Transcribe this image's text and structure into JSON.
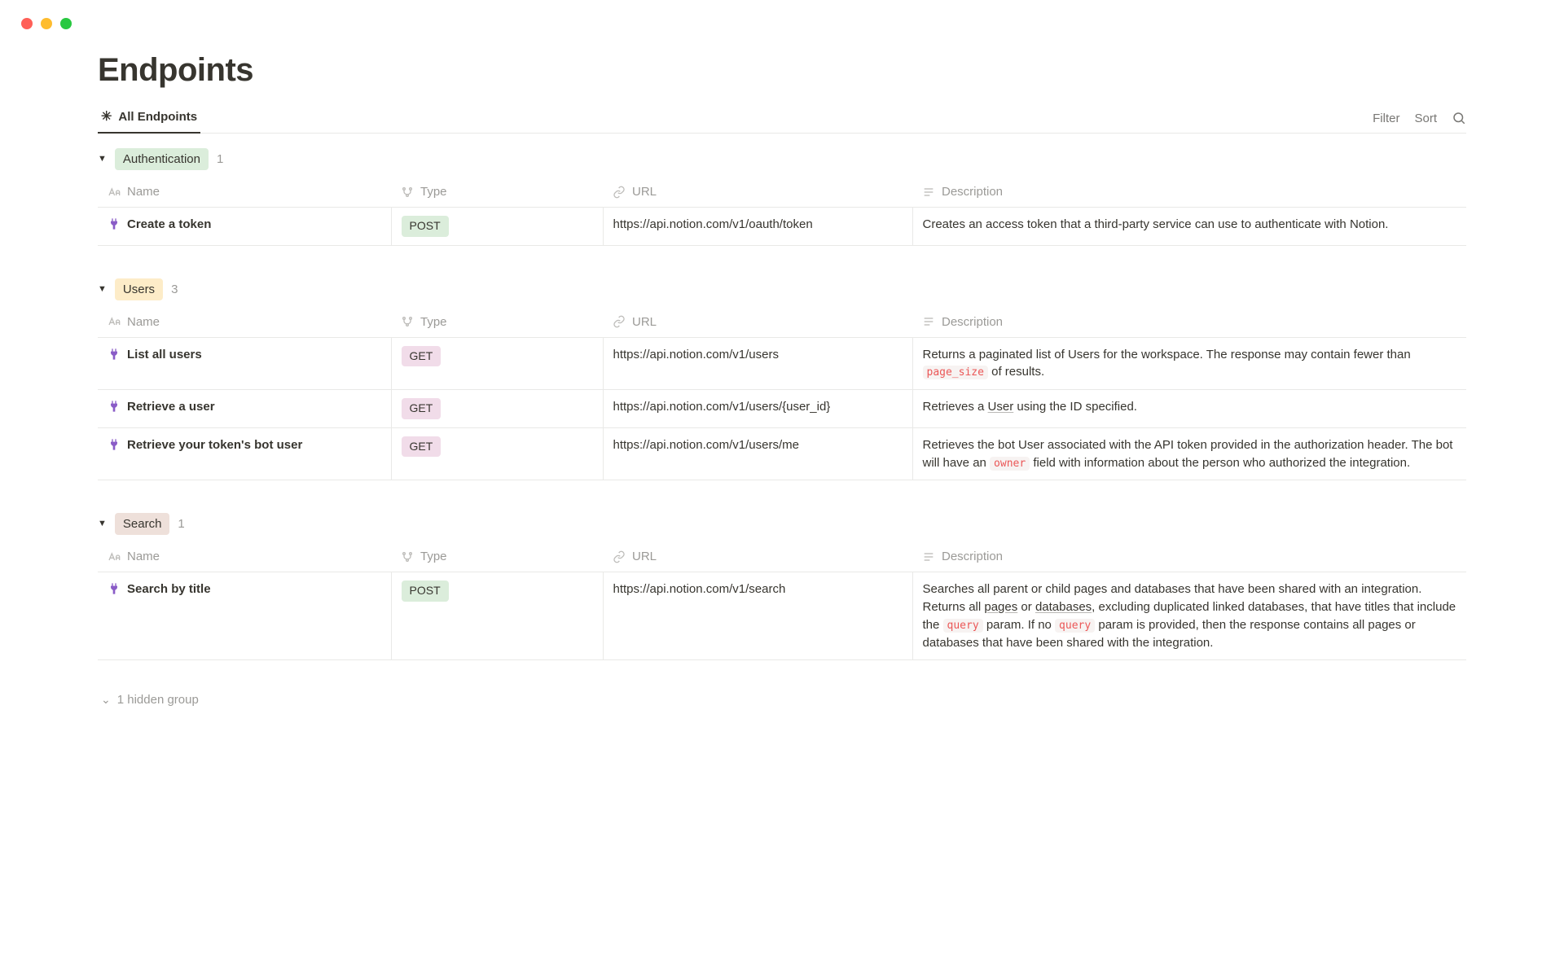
{
  "page": {
    "title": "Endpoints"
  },
  "tabs": {
    "current": "All Endpoints"
  },
  "toolbar": {
    "filter": "Filter",
    "sort": "Sort"
  },
  "columns": {
    "name": "Name",
    "type": "Type",
    "url": "URL",
    "description": "Description"
  },
  "groups": [
    {
      "label": "Authentication",
      "count": "1",
      "color": "tag-green",
      "rows": [
        {
          "name": "Create a token",
          "type": "POST",
          "type_color": "tag-green",
          "url": "https://api.notion.com/v1/oauth/token",
          "description": [
            {
              "text": "Creates an access token that a third-party service can use to authenticate with Notion."
            }
          ]
        }
      ]
    },
    {
      "label": "Users",
      "count": "3",
      "color": "tag-yellow",
      "rows": [
        {
          "name": "List all users",
          "type": "GET",
          "type_color": "tag-pink",
          "url": "https://api.notion.com/v1/users",
          "description": [
            {
              "text": "Returns a paginated list of Users for the workspace. The response may contain fewer than "
            },
            {
              "code": "page_size"
            },
            {
              "text": " of results."
            }
          ]
        },
        {
          "name": "Retrieve a user",
          "type": "GET",
          "type_color": "tag-pink",
          "url": "https://api.notion.com/v1/users/{user_id}",
          "description": [
            {
              "text": "Retrieves a "
            },
            {
              "link": "User"
            },
            {
              "text": " using the ID specified."
            }
          ]
        },
        {
          "name": "Retrieve your token's bot user",
          "type": "GET",
          "type_color": "tag-pink",
          "url": "https://api.notion.com/v1/users/me",
          "description": [
            {
              "text": "Retrieves the bot User associated with the API token provided in the authorization header. The bot will have an "
            },
            {
              "code": "owner"
            },
            {
              "text": " field with information about the person who authorized the integration."
            }
          ]
        }
      ]
    },
    {
      "label": "Search",
      "count": "1",
      "color": "tag-brown",
      "rows": [
        {
          "name": "Search by title",
          "type": "POST",
          "type_color": "tag-green",
          "url": "https://api.notion.com/v1/search",
          "description": [
            {
              "text": "Searches all parent or child pages and databases that have been shared with an integration."
            },
            {
              "br": true
            },
            {
              "text": "Returns all "
            },
            {
              "link": "pages"
            },
            {
              "text": " or "
            },
            {
              "link": "databases"
            },
            {
              "text": ", excluding duplicated linked databases, that have titles that include the "
            },
            {
              "code": "query"
            },
            {
              "text": " param. If no "
            },
            {
              "code": "query"
            },
            {
              "text": " param is provided, then the response contains all pages or databases that have been shared with the integration."
            }
          ]
        }
      ]
    }
  ],
  "hidden_groups": "1 hidden group"
}
